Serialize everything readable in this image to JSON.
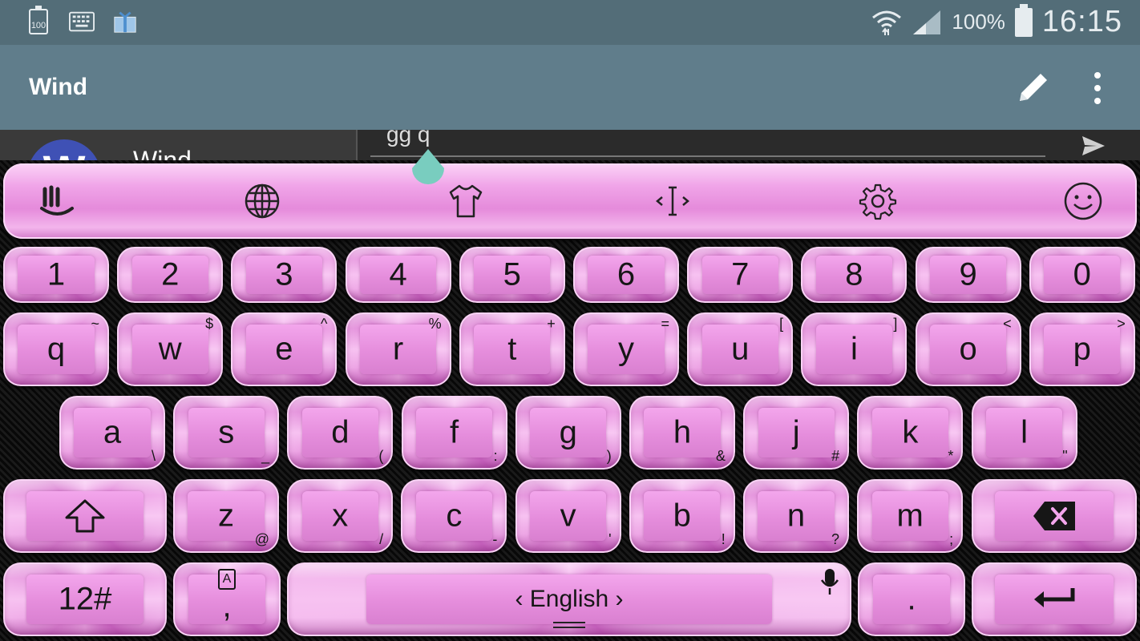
{
  "status_bar": {
    "battery_small_label": "100",
    "battery_percent": "100%",
    "time": "16:15",
    "icons": [
      "battery-100-icon",
      "keyboard-icon",
      "gift-box-icon",
      "wifi-icon",
      "signal-icon",
      "battery-icon"
    ]
  },
  "app_bar": {
    "title": "Wind",
    "actions": [
      "edit-pencil-icon",
      "more-vert-icon"
    ]
  },
  "conversation": {
    "avatar_letter": "W",
    "avatar_color": "#3f51b5",
    "name": "Wind",
    "message_input": "gg q"
  },
  "keyboard": {
    "toolbar_icons": [
      "touchpal-logo-icon",
      "globe-icon",
      "tshirt-theme-icon",
      "cursor-edit-icon",
      "settings-gear-icon",
      "emoji-smile-icon"
    ],
    "number_row": [
      "1",
      "2",
      "3",
      "4",
      "5",
      "6",
      "7",
      "8",
      "9",
      "0"
    ],
    "row1": [
      {
        "main": "q",
        "sec": "~"
      },
      {
        "main": "w",
        "sec": "$"
      },
      {
        "main": "e",
        "sec": "^"
      },
      {
        "main": "r",
        "sec": "%"
      },
      {
        "main": "t",
        "sec": "+"
      },
      {
        "main": "y",
        "sec": "="
      },
      {
        "main": "u",
        "sec": "["
      },
      {
        "main": "i",
        "sec": "]"
      },
      {
        "main": "o",
        "sec": "<"
      },
      {
        "main": "p",
        "sec": ">"
      }
    ],
    "row2": [
      {
        "main": "a",
        "sec": "\\"
      },
      {
        "main": "s",
        "sec": "_"
      },
      {
        "main": "d",
        "sec": "("
      },
      {
        "main": "f",
        "sec": ":"
      },
      {
        "main": "g",
        "sec": ")"
      },
      {
        "main": "h",
        "sec": "&"
      },
      {
        "main": "j",
        "sec": "#"
      },
      {
        "main": "k",
        "sec": "*"
      },
      {
        "main": "l",
        "sec": "\""
      }
    ],
    "row3": [
      {
        "main": "z",
        "sec": "@"
      },
      {
        "main": "x",
        "sec": "/"
      },
      {
        "main": "c",
        "sec": "-"
      },
      {
        "main": "v",
        "sec": "'"
      },
      {
        "main": "b",
        "sec": "!"
      },
      {
        "main": "n",
        "sec": "?"
      },
      {
        "main": "m",
        "sec": ";"
      }
    ],
    "symbols_key": "12#",
    "comma_key": ",",
    "comma_badge": "A",
    "space_language": "‹  English  ›",
    "period_key": ".",
    "key_color": "#e58ddc"
  }
}
